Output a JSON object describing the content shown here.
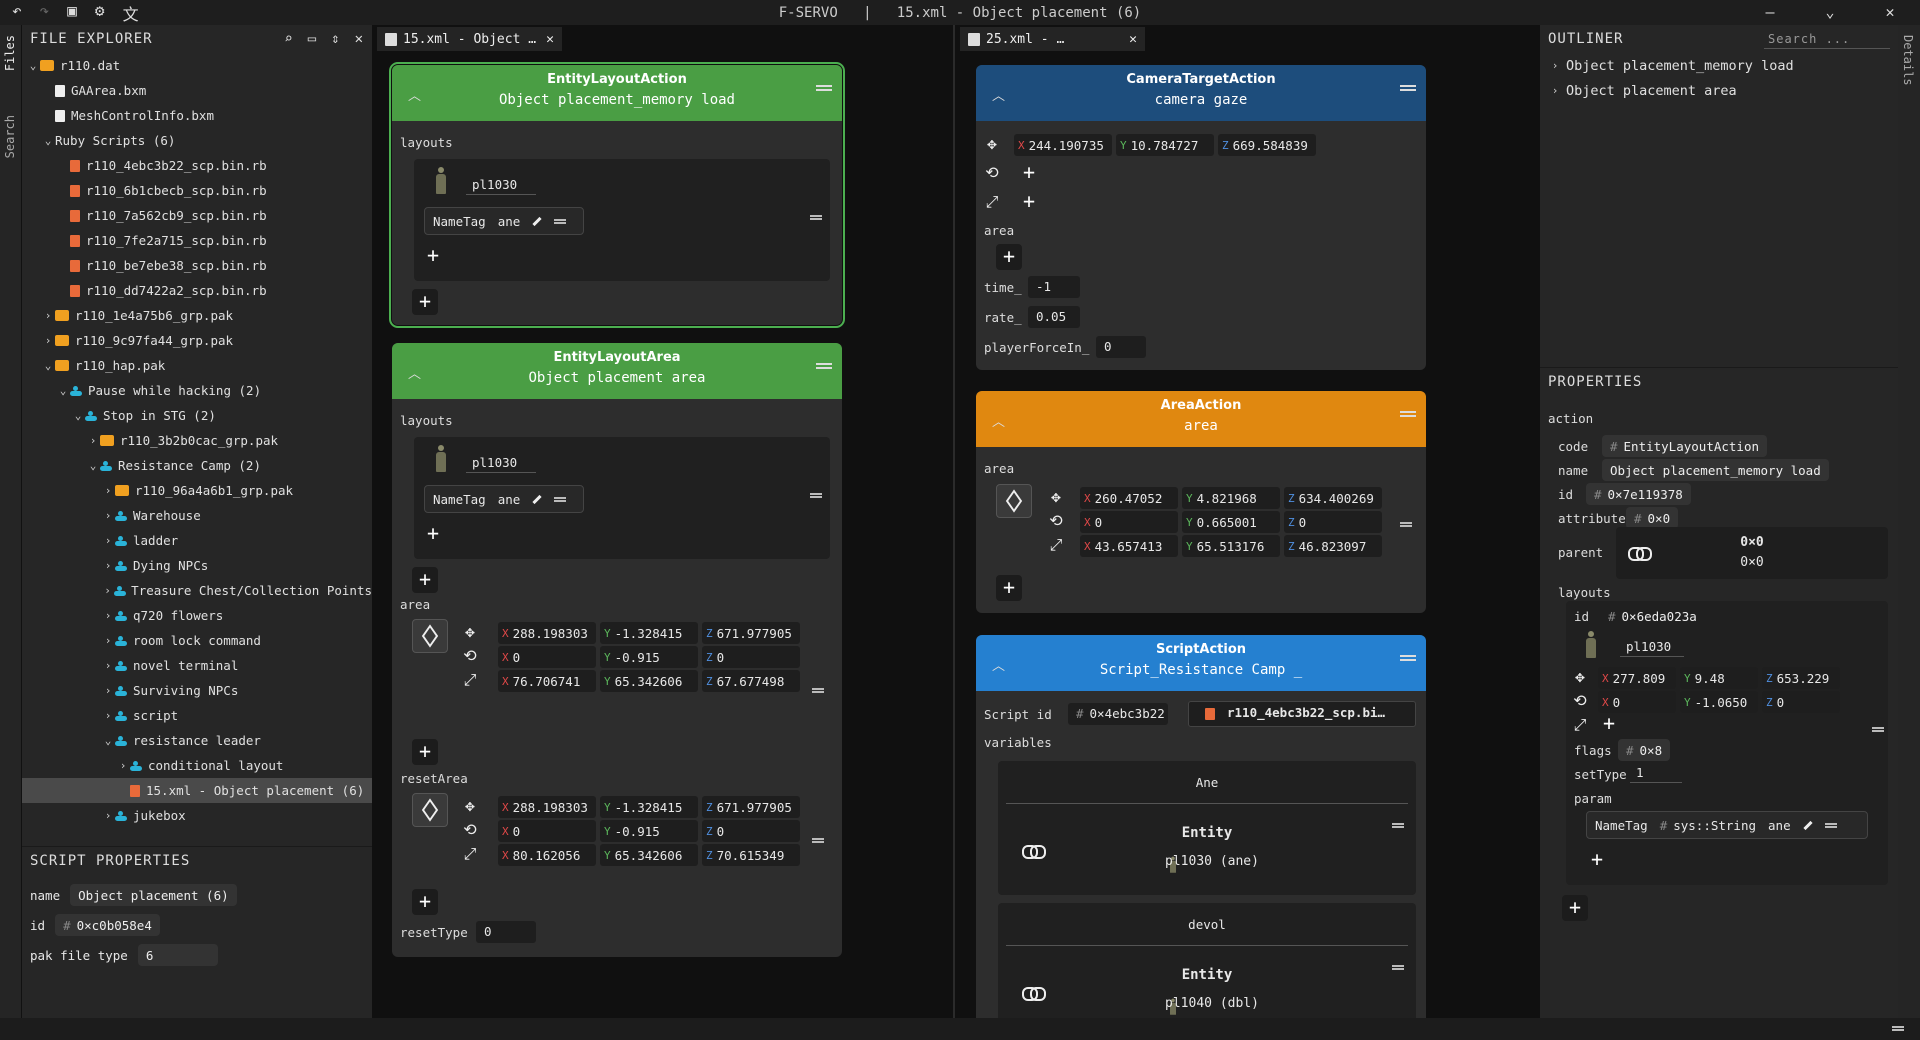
{
  "title": {
    "app": "F-SERVO",
    "sep": "|",
    "file": "15.xml - Object placement (6)"
  },
  "window_controls": {
    "minimize": "–",
    "dropdown": "⌄",
    "close": "✕"
  },
  "activity": {
    "files": "Files",
    "search": "Search",
    "details": "Details"
  },
  "explorer": {
    "title": "FILE EXPLORER",
    "items": [
      {
        "label": "r110.dat",
        "type": "folder",
        "depth": 0,
        "arrow": "⌄"
      },
      {
        "label": "GAArea.bxm",
        "type": "file",
        "depth": 1,
        "arrow": ""
      },
      {
        "label": "MeshControlInfo.bxm",
        "type": "file",
        "depth": 1,
        "arrow": ""
      },
      {
        "label": "Ruby Scripts (6)",
        "type": "none",
        "depth": 1,
        "arrow": "⌄"
      },
      {
        "label": "r110_4ebc3b22_scp.bin.rb",
        "type": "ruby",
        "depth": 2,
        "arrow": ""
      },
      {
        "label": "r110_6b1cbecb_scp.bin.rb",
        "type": "ruby",
        "depth": 2,
        "arrow": ""
      },
      {
        "label": "r110_7a562cb9_scp.bin.rb",
        "type": "ruby",
        "depth": 2,
        "arrow": ""
      },
      {
        "label": "r110_7fe2a715_scp.bin.rb",
        "type": "ruby",
        "depth": 2,
        "arrow": ""
      },
      {
        "label": "r110_be7ebe38_scp.bin.rb",
        "type": "ruby",
        "depth": 2,
        "arrow": ""
      },
      {
        "label": "r110_dd7422a2_scp.bin.rb",
        "type": "ruby",
        "depth": 2,
        "arrow": ""
      },
      {
        "label": "r110_1e4a75b6_grp.pak",
        "type": "folder",
        "depth": 1,
        "arrow": "›"
      },
      {
        "label": "r110_9c97fa44_grp.pak",
        "type": "folder",
        "depth": 1,
        "arrow": "›"
      },
      {
        "label": "r110_hap.pak",
        "type": "folder",
        "depth": 1,
        "arrow": "⌄"
      },
      {
        "label": "Pause while hacking (2)",
        "type": "node",
        "depth": 2,
        "arrow": "⌄"
      },
      {
        "label": "Stop in STG (2)",
        "type": "node",
        "depth": 3,
        "arrow": "⌄"
      },
      {
        "label": "r110_3b2b0cac_grp.pak",
        "type": "folder",
        "depth": 4,
        "arrow": "›"
      },
      {
        "label": "Resistance Camp (2)",
        "type": "node",
        "depth": 4,
        "arrow": "⌄"
      },
      {
        "label": "r110_96a4a6b1_grp.pak",
        "type": "folder",
        "depth": 5,
        "arrow": "›"
      },
      {
        "label": "Warehouse",
        "type": "node",
        "depth": 5,
        "arrow": "›"
      },
      {
        "label": "ladder",
        "type": "node",
        "depth": 5,
        "arrow": "›"
      },
      {
        "label": "Dying NPCs",
        "type": "node",
        "depth": 5,
        "arrow": "›"
      },
      {
        "label": "Treasure Chest/Collection Points",
        "type": "node",
        "depth": 5,
        "arrow": "›"
      },
      {
        "label": "q720 flowers",
        "type": "node",
        "depth": 5,
        "arrow": "›"
      },
      {
        "label": "room lock command",
        "type": "node",
        "depth": 5,
        "arrow": "›"
      },
      {
        "label": "novel terminal",
        "type": "node",
        "depth": 5,
        "arrow": "›"
      },
      {
        "label": "Surviving NPCs",
        "type": "node",
        "depth": 5,
        "arrow": "›"
      },
      {
        "label": "script",
        "type": "node",
        "depth": 5,
        "arrow": "›"
      },
      {
        "label": "resistance leader",
        "type": "node",
        "depth": 5,
        "arrow": "⌄"
      },
      {
        "label": "conditional layout",
        "type": "node",
        "depth": 6,
        "arrow": "›"
      },
      {
        "label": "15.xml - Object placement (6)",
        "type": "ruby",
        "depth": 6,
        "arrow": "",
        "selected": true
      },
      {
        "label": "jukebox",
        "type": "node",
        "depth": 5,
        "arrow": "›"
      }
    ]
  },
  "script_props": {
    "title": "SCRIPT PROPERTIES",
    "name_label": "name",
    "name": "Object placement (6)",
    "id_label": "id",
    "id": "0×c0b058e4",
    "pak_label": "pak file type",
    "pak": "6"
  },
  "tabs": {
    "left": "15.xml - Object …",
    "right": "25.xml - …",
    "close": "✕"
  },
  "common": {
    "plus": "+",
    "hash": "#",
    "x": "X",
    "y": "Y",
    "z": "Z"
  },
  "node1": {
    "type": "EntityLayoutAction",
    "name": "Object placement_memory load",
    "layouts": "layouts",
    "entity": "pl1030",
    "tag_key": "NameTag",
    "tag_val": "ane"
  },
  "node2": {
    "type": "EntityLayoutArea",
    "name": "Object placement area",
    "layouts": "layouts",
    "entity": "pl1030",
    "tag_key": "NameTag",
    "tag_val": "ane",
    "area": "area",
    "area_pos": [
      "288.198303",
      "-1.328415",
      "671.977905"
    ],
    "area_rot": [
      "0",
      "-0.915",
      "0"
    ],
    "area_scale": [
      "76.706741",
      "65.342606",
      "67.677498"
    ],
    "reset": "resetArea",
    "reset_pos": [
      "288.198303",
      "-1.328415",
      "671.977905"
    ],
    "reset_rot": [
      "0",
      "-0.915",
      "0"
    ],
    "reset_scale": [
      "80.162056",
      "65.342606",
      "70.615349"
    ],
    "reset_type_label": "resetType",
    "reset_type": "0"
  },
  "node3": {
    "type": "CameraTargetAction",
    "name": "camera gaze",
    "pos": [
      "244.190735",
      "10.784727",
      "669.584839"
    ],
    "area": "area",
    "time_label": "time_",
    "time": "-1",
    "rate_label": "rate_",
    "rate": "0.05",
    "force_label": "playerForceIn_",
    "force": "0"
  },
  "node4": {
    "type": "AreaAction",
    "name": "area",
    "area": "area",
    "pos": [
      "260.47052",
      "4.821968",
      "634.400269"
    ],
    "rot": [
      "0",
      "0.665001",
      "0"
    ],
    "scale": [
      "43.657413",
      "65.513176",
      "46.823097"
    ]
  },
  "node5": {
    "type": "ScriptAction",
    "name": "Script_Resistance Camp _",
    "script_id_label": "Script id",
    "script_id": "0×4ebc3b22",
    "script_file": "r110_4ebc3b22_scp.bi…",
    "variables": "variables",
    "vars": [
      {
        "name": "Ane",
        "kind": "Entity",
        "value": "pl1030 (ane)"
      },
      {
        "name": "devol",
        "kind": "Entity",
        "value": "pl1040 (dbl)"
      }
    ]
  },
  "outliner": {
    "title": "OUTLINER",
    "search": "Search ...",
    "items": [
      "Object placement_memory load",
      "Object placement area"
    ],
    "arrow": "›"
  },
  "properties": {
    "title": "PROPERTIES",
    "action": "action",
    "code_label": "code",
    "code": "EntityLayoutAction",
    "name_label": "name",
    "name": "Object placement_memory load",
    "id_label": "id",
    "id": "0×7e119378",
    "attr_label": "attribute",
    "attr": "0×0",
    "parent_label": "parent",
    "parent_top": "0×0",
    "parent_bottom": "0×0",
    "layouts": "layouts",
    "lay_id_label": "id",
    "lay_id": "0×6eda023a",
    "entity": "pl1030",
    "pos": [
      "277.809",
      "9.48",
      "653.229"
    ],
    "rot": [
      "0",
      "-1.0650",
      "0"
    ],
    "flags_label": "flags",
    "flags": "0×8",
    "settype_label": "setType",
    "settype": "1",
    "param_label": "param",
    "param_key": "NameTag",
    "param_type": "sys::String",
    "param_val": "ane"
  }
}
